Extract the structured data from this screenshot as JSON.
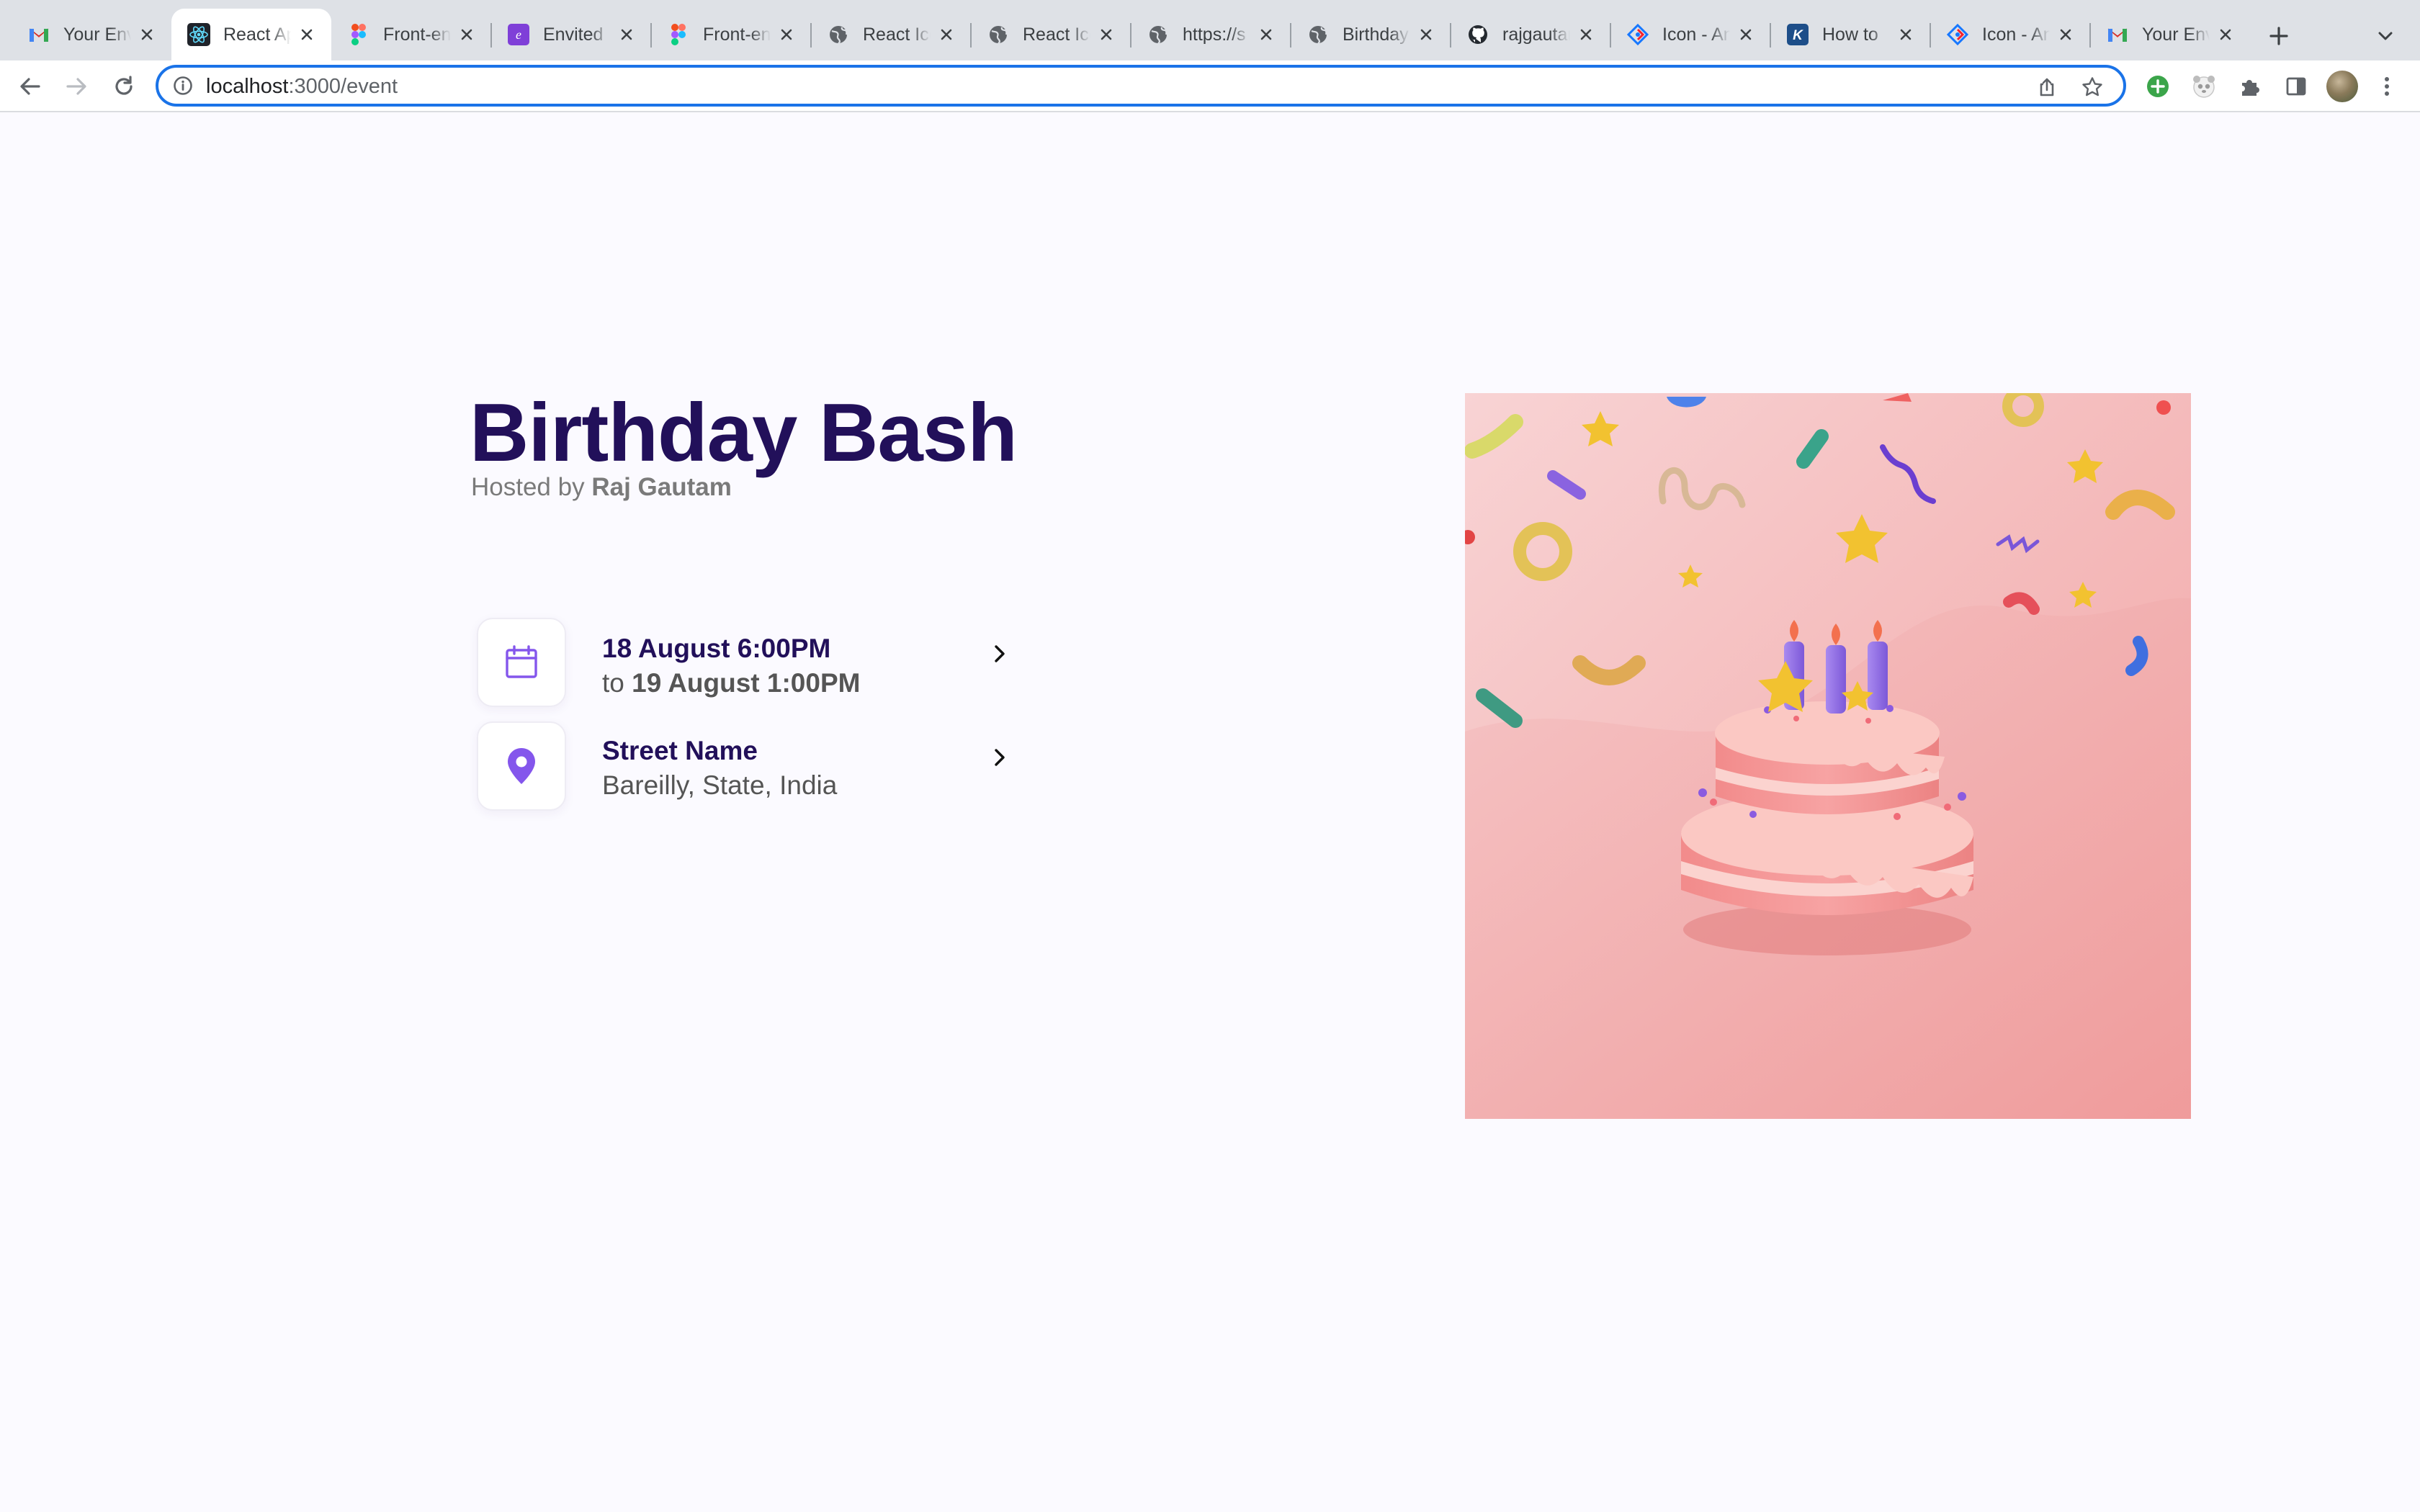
{
  "browser": {
    "tabs": [
      {
        "title": "Your Envited Tasks",
        "favicon": "gmail-icon",
        "active": false
      },
      {
        "title": "React App",
        "favicon": "react-icon",
        "active": true
      },
      {
        "title": "Front-end Task",
        "favicon": "figma-icon",
        "active": false
      },
      {
        "title": "Envited",
        "favicon": "envited-icon",
        "active": false
      },
      {
        "title": "Front-end Task",
        "favicon": "figma-icon",
        "active": false
      },
      {
        "title": "React Icons",
        "favicon": "globe-icon",
        "active": false
      },
      {
        "title": "React Icons",
        "favicon": "globe-icon",
        "active": false
      },
      {
        "title": "https://s",
        "favicon": "globe-icon",
        "active": false
      },
      {
        "title": "Birthday",
        "favicon": "globe-icon",
        "active": false
      },
      {
        "title": "rajgautam",
        "favicon": "github-icon",
        "active": false
      },
      {
        "title": "Icon - Ant Design",
        "favicon": "ant-design-icon",
        "active": false
      },
      {
        "title": "How to",
        "favicon": "k-icon",
        "active": false
      },
      {
        "title": "Icon - Ant Design",
        "favicon": "ant-design-icon",
        "active": false
      },
      {
        "title": "Your Envited",
        "favicon": "gmail-icon",
        "active": false
      }
    ],
    "address": {
      "host": "localhost",
      "path": ":3000/event"
    }
  },
  "event": {
    "title": "Birthday Bash",
    "hosted_by_prefix": "Hosted by",
    "host_name": "Raj Gautam",
    "date": {
      "start": "18 August 6:00PM",
      "end_prefix": "to",
      "end": "19 August 1:00PM"
    },
    "location": {
      "street": "Street Name",
      "address": "Bareilly, State, India"
    },
    "image": "birthday-cake-illustration",
    "colors": {
      "title": "#22105a",
      "accent": "#8456ec",
      "cover_bg": "#f6c8ca"
    }
  }
}
